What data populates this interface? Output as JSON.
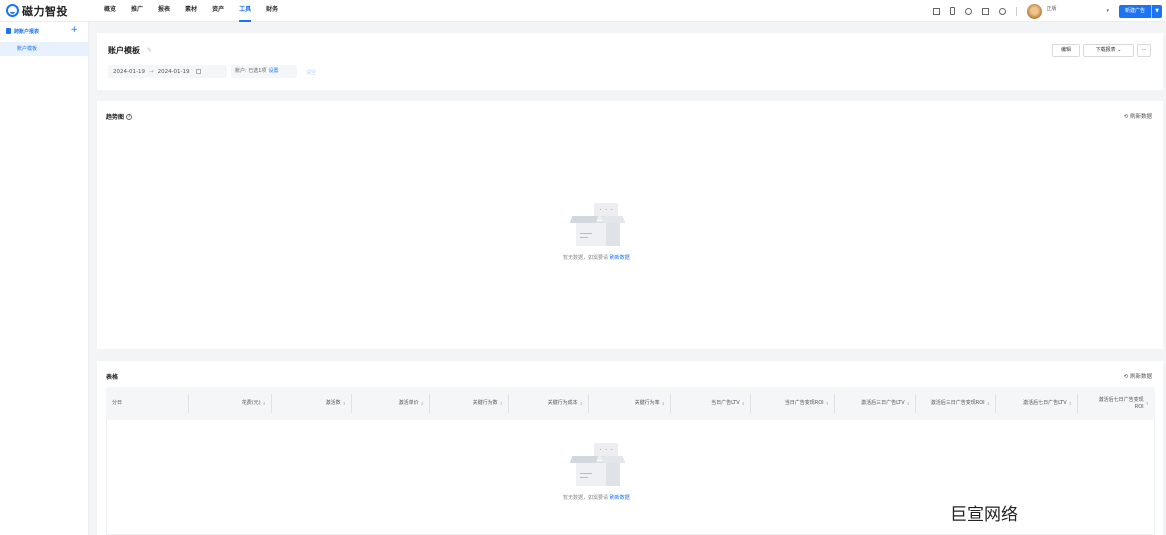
{
  "app": {
    "name": "磁力智投"
  },
  "nav": {
    "items": [
      "概览",
      "推广",
      "报表",
      "素材",
      "资产",
      "工具",
      "财务"
    ],
    "active_index": 5
  },
  "topbar": {
    "username": "正版",
    "new_ad_label": "新建广告"
  },
  "sidebar": {
    "group_label": "跨账户报表",
    "add_label": "+",
    "items": [
      {
        "label": "账户模板",
        "active": true
      }
    ]
  },
  "header": {
    "title": "账户模板",
    "date_start": "2024-01-19",
    "date_sep": "→",
    "date_end": "2024-01-19",
    "account_text": "账户: 已选1项",
    "account_set": "设置",
    "clear": "清空",
    "edit_button": "编辑",
    "download_button": "下载报表 ⌄",
    "more_button": "···"
  },
  "trend": {
    "title": "趋势图",
    "refresh": "刷新数据",
    "empty_text": "暂无数据，如需要请",
    "empty_link": "刷新数据"
  },
  "table": {
    "title": "表格",
    "refresh": "刷新数据",
    "columns": [
      "分日",
      "花费(元)",
      "激活数",
      "激活单价",
      "关键行为数",
      "关键行为成本",
      "关键行为率",
      "当日广告LTV",
      "当日广告变现ROI",
      "激活后三日广告LTV",
      "激活后三日广告变现ROI",
      "激活后七日广告LTV",
      "激活后七日广告变现ROI"
    ],
    "empty_text": "暂无数据，如需要请",
    "empty_link": "刷新数据"
  },
  "watermark": "巨宣网络",
  "colors": {
    "accent": "#1d73f5",
    "background": "#f3f4f6"
  }
}
